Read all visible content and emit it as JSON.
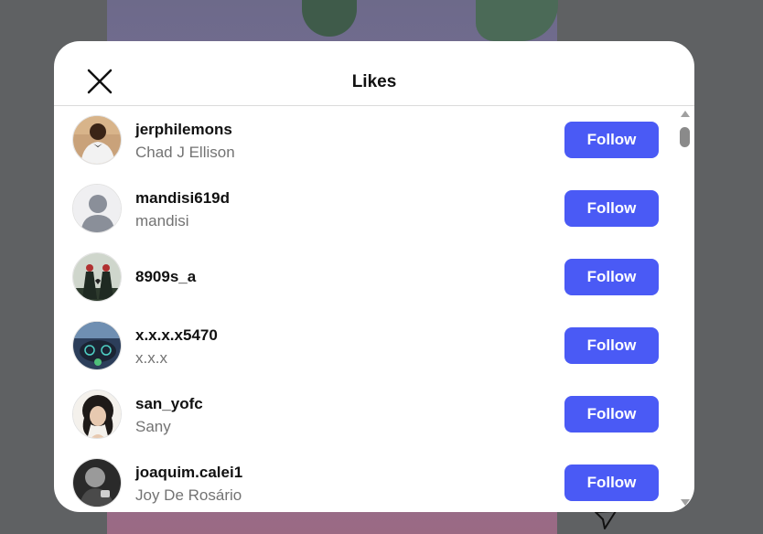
{
  "modal": {
    "title": "Likes",
    "close_icon": "close-icon"
  },
  "users": [
    {
      "username": "jerphilemons",
      "full_name": "Chad J Ellison",
      "follow_label": "Follow",
      "avatar": "photo"
    },
    {
      "username": "mandisi619d",
      "full_name": "mandisi",
      "follow_label": "Follow",
      "avatar": "default-avatar-icon"
    },
    {
      "username": "8909s_a",
      "full_name": "",
      "follow_label": "Follow",
      "avatar": "photo"
    },
    {
      "username": "x.x.x.x5470",
      "full_name": "x.x.x",
      "follow_label": "Follow",
      "avatar": "photo"
    },
    {
      "username": "san_yofc",
      "full_name": "Sany",
      "follow_label": "Follow",
      "avatar": "photo"
    },
    {
      "username": "joaquim.calei1",
      "full_name": "Joy De Rosário",
      "follow_label": "Follow",
      "avatar": "photo"
    }
  ],
  "colors": {
    "follow_button": "#4a5af5",
    "backdrop": "#5f6163"
  }
}
